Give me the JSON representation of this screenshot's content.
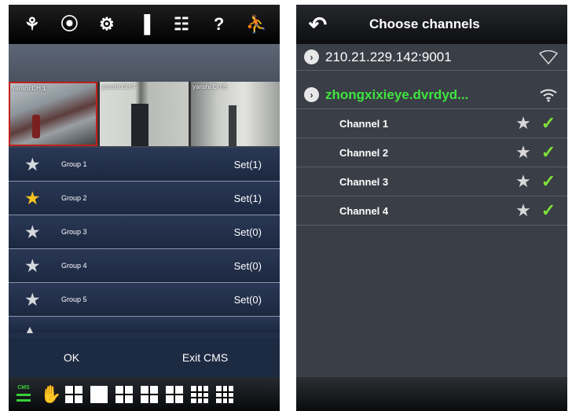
{
  "left": {
    "toolbar": {
      "icons": [
        "camera-icon",
        "video-icon",
        "gear-icon",
        "chart-icon",
        "report-icon",
        "help-icon",
        "exit-icon"
      ],
      "glyphs": [
        "⚘",
        "⦿",
        "⚙",
        "▐",
        "☷",
        "?",
        "⛹"
      ]
    },
    "thumbnails": [
      {
        "label": "yanshi:CH:1"
      },
      {
        "label": "yanshi:CH:7"
      },
      {
        "label": "yanshi:CH:8"
      }
    ],
    "groups": [
      {
        "name": "Group 1",
        "set": "Set(1)",
        "starred": false
      },
      {
        "name": "Group 2",
        "set": "Set(1)",
        "starred": true
      },
      {
        "name": "Group 3",
        "set": "Set(0)",
        "starred": false
      },
      {
        "name": "Group 4",
        "set": "Set(0)",
        "starred": false
      },
      {
        "name": "Group 5",
        "set": "Set(0)",
        "starred": false
      }
    ],
    "ok_label": "OK",
    "exit_label": "Exit CMS",
    "bottom": {
      "cms_label": "CMS"
    }
  },
  "right": {
    "title": "Choose channels",
    "devices": [
      {
        "name": "210.21.229.142:9001",
        "online": false
      },
      {
        "name": "zhongxixieye.dvrdyd...",
        "online": true
      }
    ],
    "channels": [
      {
        "name": "Channel 1",
        "checked": true
      },
      {
        "name": "Channel 2",
        "checked": true
      },
      {
        "name": "Channel 3",
        "checked": true
      },
      {
        "name": "Channel 4",
        "checked": true
      }
    ]
  },
  "colors": {
    "accent_green": "#3ee53e",
    "check_green": "#7ee23a",
    "star_gold": "#f5c320",
    "selected_border": "#c0201a"
  }
}
